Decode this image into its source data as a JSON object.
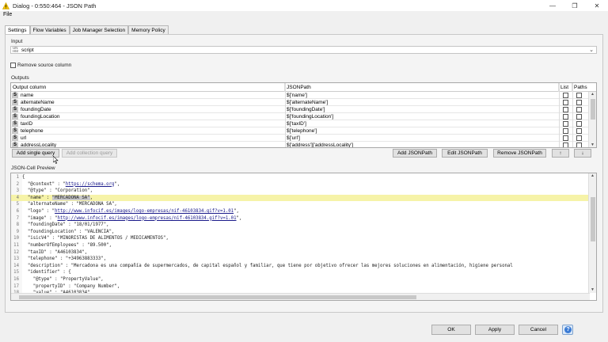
{
  "window": {
    "title": "Dialog - 0:550:464 - JSON Path",
    "minimize": "—",
    "maximize": "❐",
    "close": "✕"
  },
  "menu": {
    "file": "File"
  },
  "tabs": [
    "Settings",
    "Flow Variables",
    "Job Manager Selection",
    "Memory Policy"
  ],
  "input": {
    "label": "Input",
    "type_tag": "UN\nHM",
    "column": "script"
  },
  "remove_source": {
    "label": "Remove source column",
    "checked": false
  },
  "outputs": {
    "label": "Outputs",
    "headers": {
      "output_column": "Output column",
      "jsonpath": "JSONPath",
      "list": "List",
      "paths": "Paths"
    },
    "rows": [
      {
        "type": "S",
        "name": "name",
        "path": "$['name']"
      },
      {
        "type": "S",
        "name": "alternateName",
        "path": "$['alternateName']"
      },
      {
        "type": "S",
        "name": "foundingDate",
        "path": "$['foundingDate']"
      },
      {
        "type": "S",
        "name": "foundingLocation",
        "path": "$['foundingLocation']"
      },
      {
        "type": "S",
        "name": "taxID",
        "path": "$['taxID']"
      },
      {
        "type": "S",
        "name": "telephone",
        "path": "$['telephone']"
      },
      {
        "type": "S",
        "name": "url",
        "path": "$['url']"
      },
      {
        "type": "S",
        "name": "addressLocality",
        "path": "$['address']['addressLocality']"
      }
    ]
  },
  "buttons": {
    "add_single_query": "Add single query",
    "add_collection_query": "Add collection query",
    "add_jsonpath": "Add JSONPath",
    "edit_jsonpath": "Edit JSONPath",
    "remove_jsonpath": "Remove JSONPath",
    "move_up": "↑",
    "move_down": "↓",
    "ok": "OK",
    "apply": "Apply",
    "cancel": "Cancel",
    "help": "?"
  },
  "preview": {
    "label": "JSON-Cell Preview",
    "highlighted_line": 4,
    "lines": [
      "{",
      "  \"@context\" : \"https://schema.org\",",
      "  \"@type\" : \"Corporation\",",
      "  \"name\" : \"MERCADONA SA\",",
      "  \"alternateName\" : \"MERCADONA SA\",",
      "  \"logo\" : \"http://www.infocif.es/images/logo-empresas/nif-46103834.gif?v=1.01\",",
      "  \"image\" : \"http://www.infocif.es/images/logo-empresas/nif-46103834.gif?v=1.01\",",
      "  \"foundingDate\" : \"18/01/1977\",",
      "  \"foundingLocation\" : \"VALENCIA\",",
      "  \"isicV4\" : \"MINORISTAS DE ALIMENTOS / MEDICAMENTOS\",",
      "  \"numberOfEmployees\" : \"89.500\",",
      "  \"taxID\" : \"A46103834\",",
      "  \"telephone\" : \"+34963883333\",",
      "  \"description\" : \"Mercadona es una compañía de supermercados, de capital español y familiar, que tiene por objetivo ofrecer las mejores soluciones en alimentación, higiene personal",
      "  \"identifier\" : {",
      "    \"@type\" : \"PropertyValue\",",
      "    \"propertyID\" : \"Company Number\",",
      "    \"value\" : \"A46103834\""
    ]
  },
  "colors": {
    "highlight": "#f6f3a8",
    "selection": "#c8c8c8",
    "help_blue": "#3a7bd5"
  }
}
